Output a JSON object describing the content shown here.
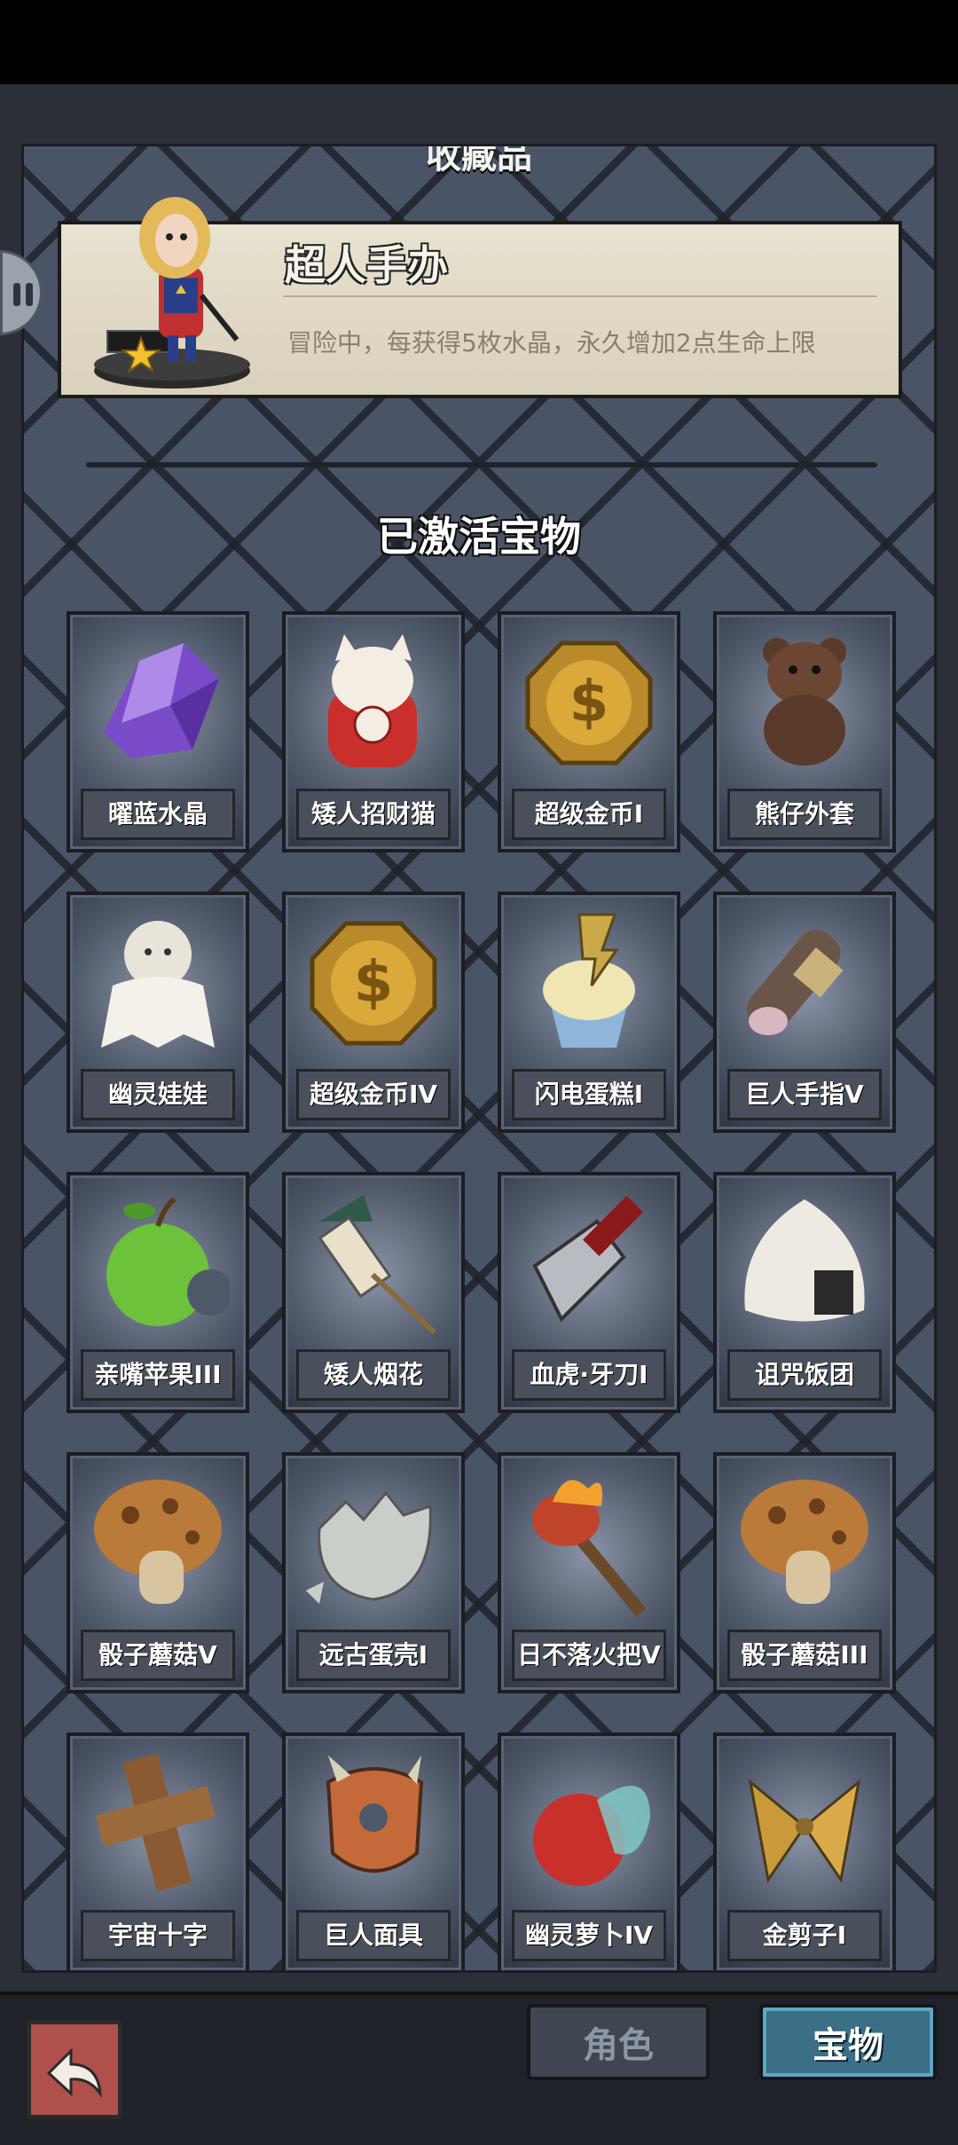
{
  "panel": {
    "title": "收藏品"
  },
  "featured": {
    "name": "超人手办",
    "description": "冒险中，每获得5枚水晶，永久增加2点生命上限",
    "star_color": "#f2c12e"
  },
  "section_title": "已激活宝物",
  "items": [
    {
      "label": "曜蓝水晶",
      "icon": "purple-crystal-icon"
    },
    {
      "label": "矮人招财猫",
      "icon": "lucky-cat-icon"
    },
    {
      "label": "超级金币I",
      "icon": "gold-coin-icon"
    },
    {
      "label": "熊仔外套",
      "icon": "teddy-bear-icon"
    },
    {
      "label": "幽灵娃娃",
      "icon": "ghost-doll-icon"
    },
    {
      "label": "超级金币IV",
      "icon": "gold-coin-icon"
    },
    {
      "label": "闪电蛋糕I",
      "icon": "lightning-cupcake-icon"
    },
    {
      "label": "巨人手指V",
      "icon": "giant-finger-icon"
    },
    {
      "label": "亲嘴苹果III",
      "icon": "green-apple-icon"
    },
    {
      "label": "矮人烟花",
      "icon": "firework-icon"
    },
    {
      "label": "血虎·牙刀I",
      "icon": "cleaver-icon"
    },
    {
      "label": "诅咒饭团",
      "icon": "rice-ball-icon"
    },
    {
      "label": "骰子蘑菇V",
      "icon": "mushroom-icon"
    },
    {
      "label": "远古蛋壳I",
      "icon": "eggshell-icon"
    },
    {
      "label": "日不落火把V",
      "icon": "torch-icon"
    },
    {
      "label": "骰子蘑菇III",
      "icon": "mushroom-icon"
    },
    {
      "label": "宇宙十字",
      "icon": "wooden-cross-icon"
    },
    {
      "label": "巨人面具",
      "icon": "giant-mask-icon"
    },
    {
      "label": "幽灵萝卜IV",
      "icon": "ghost-radish-icon"
    },
    {
      "label": "金剪子I",
      "icon": "golden-scissors-icon"
    }
  ],
  "tabs": {
    "role": "角色",
    "treasure": "宝物"
  },
  "colors": {
    "panel_bg": "#4a5466",
    "active_tab": "#3b6f86",
    "back_button": "#b0504a"
  }
}
